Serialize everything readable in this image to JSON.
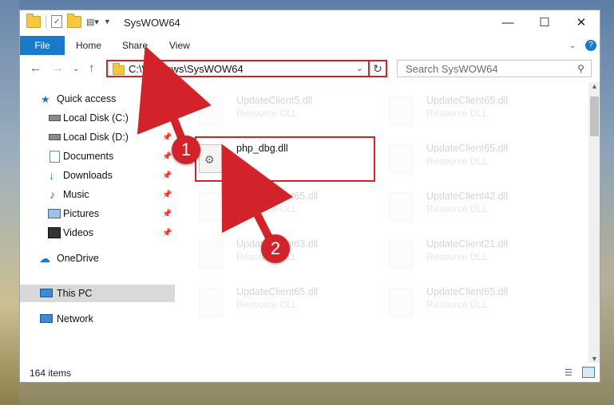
{
  "window": {
    "title": "SysWOW64"
  },
  "ribbon": {
    "tabs": [
      "File",
      "Home",
      "Share",
      "View"
    ]
  },
  "address": {
    "path": "C:\\Windows\\SysWOW64",
    "search_placeholder": "Search SysWOW64"
  },
  "sidebar": {
    "items": [
      {
        "label": "Quick access",
        "icon": "star-icon"
      },
      {
        "label": "Local Disk (C:)",
        "icon": "drive-icon"
      },
      {
        "label": "Local Disk (D:)",
        "icon": "drive-icon"
      },
      {
        "label": "Documents",
        "icon": "documents-icon"
      },
      {
        "label": "Downloads",
        "icon": "download-icon"
      },
      {
        "label": "Music",
        "icon": "music-icon"
      },
      {
        "label": "Pictures",
        "icon": "pictures-icon"
      },
      {
        "label": "Videos",
        "icon": "videos-icon"
      },
      {
        "label": "OneDrive",
        "icon": "cloud-icon"
      },
      {
        "label": "This PC",
        "icon": "computer-icon"
      },
      {
        "label": "Network",
        "icon": "network-icon"
      }
    ]
  },
  "files": [
    {
      "name": "UpdateClient5.dll",
      "desc": "Resource DLL"
    },
    {
      "name": "UpdateClient65.dll",
      "desc": "Resource DLL"
    },
    {
      "name": "php_dbg.dll",
      "desc": ""
    },
    {
      "name": "UpdateClient65.dll",
      "desc": "Resource DLL"
    },
    {
      "name": "UpdateClient65.dll",
      "desc": "Resource DLL"
    },
    {
      "name": "UpdateClient42.dll",
      "desc": "Resource DLL"
    },
    {
      "name": "UpdateClient63.dll",
      "desc": "Resource DLL"
    },
    {
      "name": "UpdateClient21.dll",
      "desc": "Resource DLL"
    },
    {
      "name": "UpdateClient65.dll",
      "desc": "Resource DLL"
    },
    {
      "name": "UpdateClient65.dll",
      "desc": "Resource DLL"
    }
  ],
  "status": {
    "count": "164 items"
  },
  "callouts": [
    "1",
    "2"
  ],
  "colors": {
    "accent": "#1979ca",
    "highlight": "#d2232a"
  }
}
